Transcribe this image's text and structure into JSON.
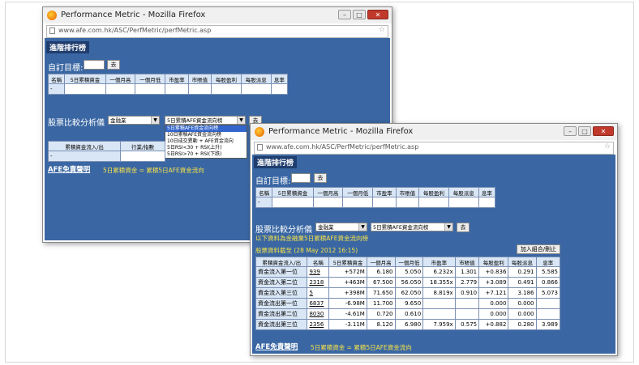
{
  "window_title": "Performance Metric - Mozilla Firefox",
  "url": "www.afe.com.hk/ASC/PerfMetric/perfMetric.asp",
  "window_buttons": [
    "–",
    "□",
    "✕"
  ],
  "page_header": "進階排行榜",
  "custom_target_label": "自訂目標:",
  "go_label": "去",
  "top_table_headers": [
    "名稱",
    "5日累積資金",
    "一個月高",
    "一個月低",
    "市盈率",
    "市賬值",
    "每股盈利",
    "每股派息",
    "息率"
  ],
  "top_table_row_label": "-",
  "compare_label": "股票比較分析儀",
  "sector_select": "金融業",
  "metric_select": "5日累積AFE資金流向榜",
  "dropdown_options": [
    "5日累積AFE資金流向榜",
    "10日累積AFE資金流向榜",
    "10日成交異動 + AFE資金流向",
    "5日RSI<30 + RSI(上升)",
    "5日RSI>70 + RSI(下跌)"
  ],
  "back_table_headers": [
    "累積資金流入/出",
    "行業/指數"
  ],
  "afe_disclaimer": "AFE免責聲明",
  "legend_note": "5日累積資金 = 累積5日AFE資金流向",
  "front_info_line1": "以下資料為金融業5日累積AFE資金流向榜",
  "front_info_line2": "股票資料截至 (28 May 2012 16:15)",
  "add_portfolio_button": "加入組合/刪止",
  "result_headers": [
    "累積資金流入/出",
    "名稱",
    "5日累積資金",
    "一個月高",
    "一個月低",
    "市盈率",
    "市賬值",
    "每股盈利",
    "每股派息",
    "息率"
  ],
  "result_rows": [
    {
      "label": "資金流入第一位",
      "code": "939",
      "flow": "+572M",
      "high": "6.180",
      "low": "5.050",
      "pe": "6.232x",
      "pb": "1.301",
      "eps": "+0.836",
      "dps": "0.291",
      "yield": "5.585"
    },
    {
      "label": "資金流入第二位",
      "code": "2318",
      "flow": "+463M",
      "high": "67.500",
      "low": "56.050",
      "pe": "18.355x",
      "pb": "2.779",
      "eps": "+3.089",
      "dps": "0.491",
      "yield": "0.866"
    },
    {
      "label": "資金流入第三位",
      "code": "5",
      "flow": "+398M",
      "high": "71.650",
      "low": "62.050",
      "pe": "8.819x",
      "pb": "0.910",
      "eps": "+7.121",
      "dps": "3.186",
      "yield": "5.073"
    },
    {
      "label": "資金流出第一位",
      "code": "6837",
      "flow": "-6.98M",
      "high": "11.700",
      "low": "9.650",
      "pe": "",
      "pb": "",
      "eps": "0.000",
      "dps": "0.000",
      "yield": ""
    },
    {
      "label": "資金流出第二位",
      "code": "8030",
      "flow": "-4.61M",
      "high": "0.720",
      "low": "0.610",
      "pe": "",
      "pb": "",
      "eps": "0.000",
      "dps": "0.000",
      "yield": ""
    },
    {
      "label": "資金流出第三位",
      "code": "2356",
      "flow": "-3.11M",
      "high": "8.120",
      "low": "6.980",
      "pe": "7.959x",
      "pb": "0.575",
      "eps": "+0.882",
      "dps": "0.280",
      "yield": "3.989"
    }
  ],
  "colors": {
    "page_bg": "#3a67a3",
    "header_bg": "#1f3d6e",
    "note_yellow": "#f4e04a",
    "positive": "#1a9a1a",
    "negative": "#d62020"
  }
}
